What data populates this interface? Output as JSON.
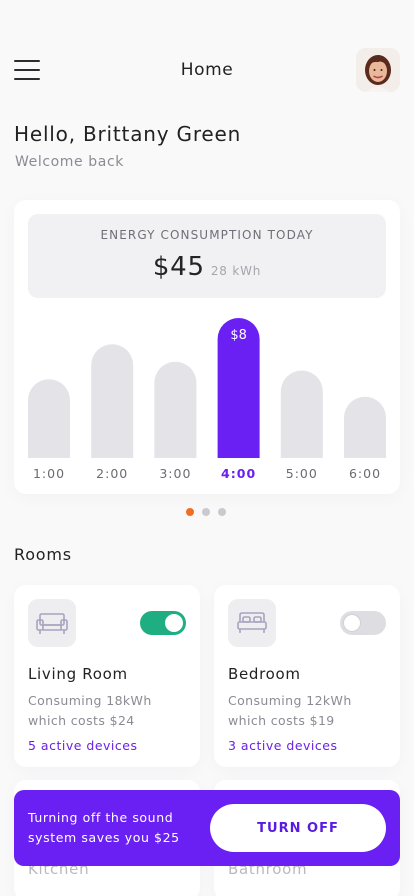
{
  "header": {
    "title": "Home"
  },
  "greeting": {
    "hello": "Hello, Brittany Green",
    "subtitle": "Welcome back"
  },
  "energy": {
    "label": "ENERGY CONSUMPTION TODAY",
    "cost": "$45",
    "kwh": "28 kWh"
  },
  "chart_data": {
    "type": "bar",
    "categories": [
      "1:00",
      "2:00",
      "3:00",
      "4:00",
      "5:00",
      "6:00"
    ],
    "values": [
      4.5,
      6.5,
      5.5,
      8,
      5,
      3.5
    ],
    "highlight_index": 3,
    "highlight_label": "$8",
    "colors": {
      "bar": "#e3e3e8",
      "highlight": "#6a1ff3",
      "tick": "#6b6b73",
      "tick_highlight": "#6a1ff3"
    }
  },
  "pager": {
    "count": 3,
    "active": 0
  },
  "rooms": {
    "title": "Rooms",
    "items": [
      {
        "name": "Living Room",
        "line1": "Consuming 18kWh",
        "line2": "which costs $24",
        "devices": "5 active devices",
        "on": true,
        "icon": "sofa-icon"
      },
      {
        "name": "Bedroom",
        "line1": "Consuming 12kWh",
        "line2": "which costs $19",
        "devices": "3 active devices",
        "on": false,
        "icon": "bed-icon"
      },
      {
        "name": "Kitchen"
      },
      {
        "name": "Bathroom"
      }
    ]
  },
  "banner": {
    "text": "Turning off the sound system saves you $25",
    "button": "TURN OFF"
  },
  "colors": {
    "accent": "#6a1ff3",
    "toggle_on": "#1fae82",
    "pager_active": "#f26d21"
  }
}
